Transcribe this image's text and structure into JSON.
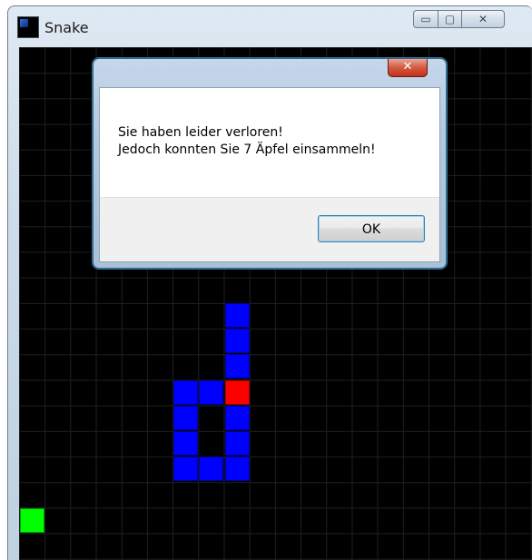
{
  "window": {
    "title": "Snake",
    "minimize_glyph": "▭",
    "maximize_glyph": "▢",
    "close_glyph": "✕"
  },
  "game": {
    "colors": {
      "background": "#000000",
      "snake": "#0000ff",
      "head": "#ff0000",
      "apple": "#00ff00"
    },
    "head_cell": {
      "col": 8,
      "row": 13
    },
    "snake_cells": [
      {
        "col": 8,
        "row": 10
      },
      {
        "col": 8,
        "row": 11
      },
      {
        "col": 8,
        "row": 12
      },
      {
        "col": 7,
        "row": 13
      },
      {
        "col": 6,
        "row": 13
      },
      {
        "col": 6,
        "row": 14
      },
      {
        "col": 8,
        "row": 14
      },
      {
        "col": 6,
        "row": 15
      },
      {
        "col": 8,
        "row": 15
      },
      {
        "col": 6,
        "row": 16
      },
      {
        "col": 7,
        "row": 16
      },
      {
        "col": 8,
        "row": 16
      }
    ],
    "apple_cell": {
      "col": 0,
      "row": 18
    }
  },
  "dialog": {
    "close_glyph": "✕",
    "message": "Sie haben leider verloren!\nJedoch konnten Sie 7 Äpfel einsammeln!",
    "ok_label": "OK"
  }
}
